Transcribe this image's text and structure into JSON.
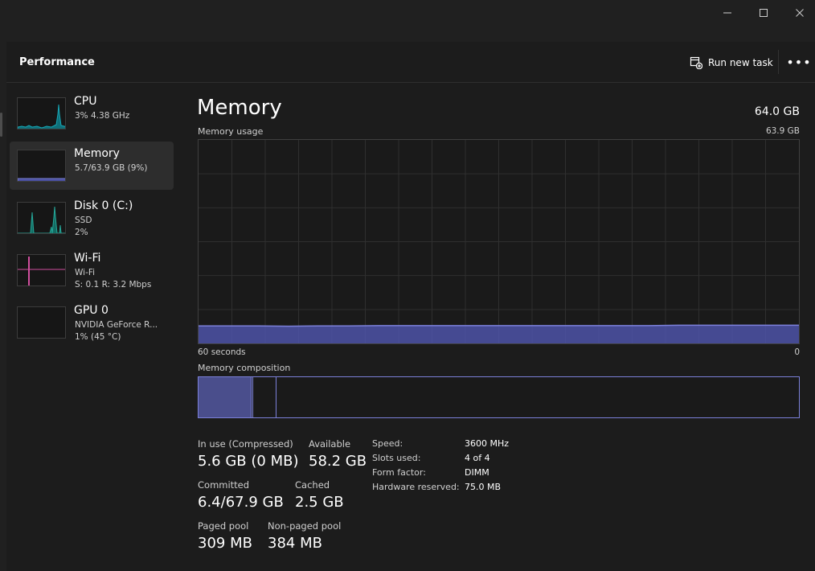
{
  "window": {
    "minimize_icon": "minimize-icon",
    "maximize_icon": "maximize-icon",
    "close_icon": "close-icon"
  },
  "header": {
    "title": "Performance",
    "run_new_task": "Run new task",
    "more_icon": "more-horizontal-icon"
  },
  "sidebar": {
    "items": [
      {
        "name": "CPU",
        "sub1": "3%  4.38 GHz",
        "sub2": "",
        "selected": false,
        "color": "#17a6b5"
      },
      {
        "name": "Memory",
        "sub1": "5.7/63.9 GB (9%)",
        "sub2": "",
        "selected": true,
        "color": "#7b80d8"
      },
      {
        "name": "Disk 0 (C:)",
        "sub1": "SSD",
        "sub2": "2%",
        "selected": false,
        "color": "#25a89a"
      },
      {
        "name": "Wi-Fi",
        "sub1": "Wi-Fi",
        "sub2": "S: 0.1  R: 3.2 Mbps",
        "selected": false,
        "color": "#d04f9e"
      },
      {
        "name": "GPU 0",
        "sub1": "NVIDIA GeForce R...",
        "sub2": "1%  (45 °C)",
        "selected": false,
        "color": "#6f74c8"
      }
    ]
  },
  "main": {
    "title": "Memory",
    "total": "64.0 GB",
    "usage_label": "Memory usage",
    "usage_max": "63.9 GB",
    "graph_left_label": "60 seconds",
    "graph_right_label": "0",
    "composition_label": "Memory composition",
    "composition": {
      "in_use_fraction": 0.088,
      "modified_fraction": 0.003,
      "standby_fraction": 0.039
    }
  },
  "chart_data": {
    "type": "area",
    "title": "Memory usage",
    "xlabel": "60 seconds",
    "ylim": [
      0,
      63.9
    ],
    "x": [
      60,
      57,
      54,
      51,
      48,
      45,
      42,
      39,
      36,
      33,
      30,
      27,
      24,
      21,
      18,
      15,
      12,
      9,
      6,
      3,
      0
    ],
    "values": [
      5.5,
      5.5,
      5.5,
      5.4,
      5.5,
      5.5,
      5.6,
      5.6,
      5.6,
      5.6,
      5.6,
      5.6,
      5.6,
      5.6,
      5.6,
      5.6,
      5.7,
      5.7,
      5.7,
      5.7,
      5.7
    ],
    "grid": true,
    "color": "#7b80d8"
  },
  "stats": {
    "in_use_label": "In use (Compressed)",
    "in_use_value": "5.6 GB (0 MB)",
    "available_label": "Available",
    "available_value": "58.2 GB",
    "committed_label": "Committed",
    "committed_value": "6.4/67.9 GB",
    "cached_label": "Cached",
    "cached_value": "2.5 GB",
    "paged_label": "Paged pool",
    "paged_value": "309 MB",
    "nonpaged_label": "Non-paged pool",
    "nonpaged_value": "384 MB"
  },
  "specs": {
    "speed_label": "Speed:",
    "speed_value": "3600 MHz",
    "slots_label": "Slots used:",
    "slots_value": "4 of 4",
    "form_label": "Form factor:",
    "form_value": "DIMM",
    "reserved_label": "Hardware reserved:",
    "reserved_value": "75.0 MB"
  }
}
